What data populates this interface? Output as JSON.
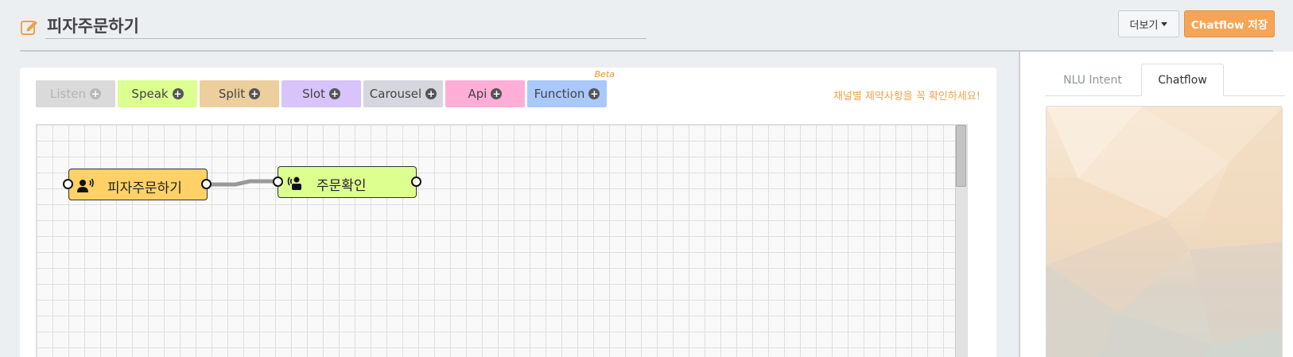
{
  "header": {
    "title": "피자주문하기",
    "title_icon": "edit-icon",
    "more_label": "더보기",
    "save_label": "Chatflow 저장"
  },
  "palette": {
    "items": [
      {
        "label": "Listen",
        "color": "#dadada",
        "enabled": false
      },
      {
        "label": "Speak",
        "color": "#dcff8f",
        "enabled": true
      },
      {
        "label": "Split",
        "color": "#eccf9d",
        "enabled": true
      },
      {
        "label": "Slot",
        "color": "#d8c4fb",
        "enabled": true
      },
      {
        "label": "Carousel",
        "color": "#d6d6de",
        "enabled": true
      },
      {
        "label": "Api",
        "color": "#ffaed7",
        "enabled": true
      },
      {
        "label": "Function",
        "color": "#a9c8fb",
        "enabled": true
      }
    ],
    "beta_label": "Beta",
    "notice": "채널별 제약사항을 꼭 확인하세요!"
  },
  "canvas": {
    "nodes": [
      {
        "label": "피자주문하기",
        "icon": "listen-user-icon",
        "color": "#ffd166"
      },
      {
        "label": "주문확인",
        "icon": "speak-bot-icon",
        "color": "#dcff8f"
      }
    ]
  },
  "right_panel": {
    "tabs": [
      {
        "label": "NLU Intent",
        "active": false
      },
      {
        "label": "Chatflow",
        "active": true
      }
    ]
  },
  "colors": {
    "accent": "#f6a556",
    "background": "#ebeff2"
  }
}
